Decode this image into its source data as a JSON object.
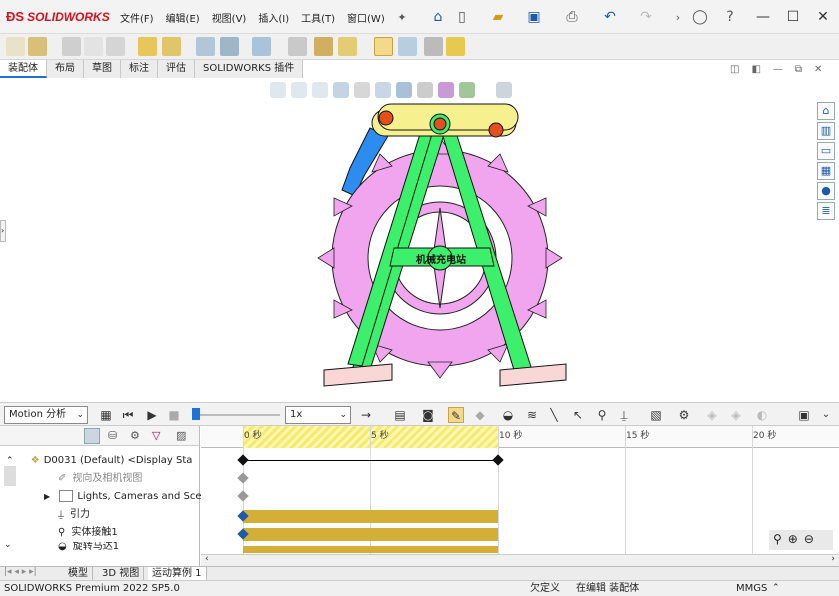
{
  "app": {
    "logo": "SOLIDWORKS",
    "menus": [
      "文件(F)",
      "编辑(E)",
      "视图(V)",
      "插入(I)",
      "工具(T)",
      "窗口(W)"
    ]
  },
  "command_tabs": [
    "装配体",
    "布局",
    "草图",
    "标注",
    "评估",
    "SOLIDWORKS 插件"
  ],
  "model": {
    "label": "机械充电站"
  },
  "motion": {
    "study_type": "Motion 分析",
    "playback_speed": "1x",
    "tree": {
      "root": "D0031 (Default) <Display Sta",
      "items": [
        "视向及相机视图",
        "Lights, Cameras and Sce",
        "引力",
        "实体接触1",
        "旋转马达1"
      ]
    },
    "timeline": {
      "ticks": [
        "0 秒",
        "5 秒",
        "10 秒",
        "15 秒",
        "20 秒"
      ]
    }
  },
  "bottom_tabs": [
    "模型",
    "3D 视图",
    "运动算例 1"
  ],
  "status": {
    "product": "SOLIDWORKS Premium 2022 SP5.0",
    "definition": "欠定义",
    "editing": "在编辑 装配体",
    "units": "MMGS"
  }
}
